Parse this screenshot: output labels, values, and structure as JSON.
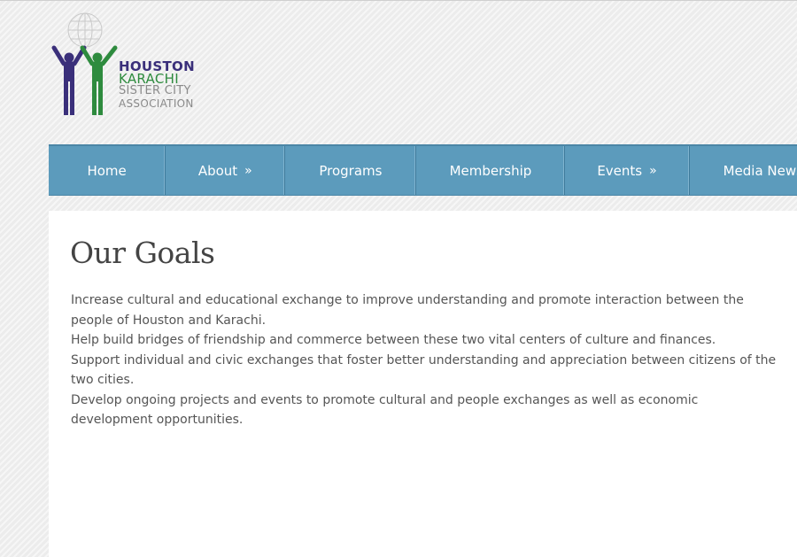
{
  "logo": {
    "line1": "HOUSTON",
    "line2": "KARACHI",
    "line3": "SISTER CITY",
    "line4": "ASSOCIATION",
    "colors": {
      "purple": "#3a2f7a",
      "green": "#2e8b3e",
      "gray": "#8a8a8a"
    }
  },
  "nav": {
    "items": [
      {
        "label": "Home",
        "has_submenu": false
      },
      {
        "label": "About",
        "has_submenu": true,
        "arrow": "»"
      },
      {
        "label": "Programs",
        "has_submenu": false
      },
      {
        "label": "Membership",
        "has_submenu": false
      },
      {
        "label": "Events",
        "has_submenu": true,
        "arrow": "»"
      },
      {
        "label": "Media News",
        "has_submenu": false
      }
    ],
    "background": "#5c9bbc"
  },
  "content": {
    "title": "Our Goals",
    "paragraphs": [
      "Increase cultural and educational exchange to improve understanding and promote interaction between the people of Houston and Karachi.",
      "Help build bridges of friendship and commerce between these two vital centers of culture and finances.",
      "Support individual and civic exchanges that foster better understanding and appreciation between citizens of the two cities.",
      "Develop ongoing projects and events to promote cultural and people exchanges as well as economic development opportunities."
    ]
  }
}
